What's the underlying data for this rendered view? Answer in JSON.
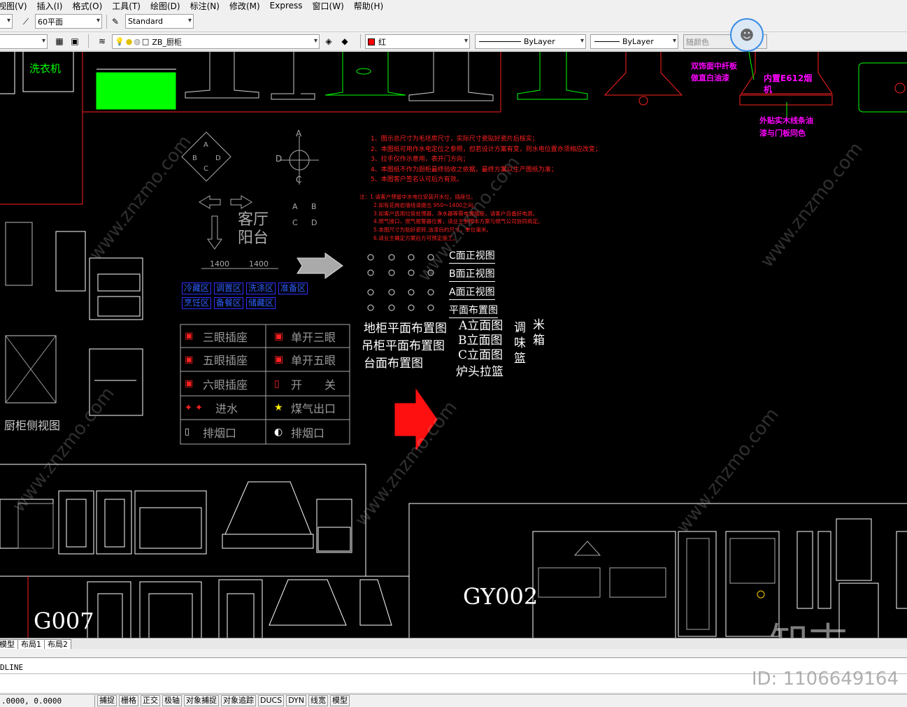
{
  "menu": [
    "视图(V)",
    "插入(I)",
    "格式(O)",
    "工具(T)",
    "绘图(D)",
    "标注(N)",
    "修改(M)",
    "Express",
    "窗口(W)",
    "帮助(H)"
  ],
  "toolbar1": {
    "dim_style": "60平面",
    "text_style": "Standard"
  },
  "toolbar2": {
    "layer": "ZB_厨柜",
    "color": "红",
    "linetype": "ByLayer",
    "lineweight": "ByLayer",
    "plotstyle": "随颜色"
  },
  "colors": {
    "canvas": "#000000",
    "red": "#ff2020",
    "green": "#00ff00",
    "magenta": "#ff00ff",
    "blue": "#3030ff",
    "white": "#ffffff"
  },
  "drawing": {
    "washer_label": "洗衣机",
    "annot_left": [
      "双饰面中纤板",
      "做直白油漆"
    ],
    "annot_built_in": [
      "内置E612烟",
      "机"
    ],
    "annot_right": [
      "外贴实木线条油",
      "漆与门板同色"
    ],
    "notes_red": [
      "1、图示总尺寸为毛坯房尺寸，实际尺寸瓷贴好瓷片后核实；",
      "2、本图纸可用作水电定位之参照，但若设计方案有变，则水电位置亦须相应改变；",
      "3、拉手仅作示意用，表开门方向；",
      "4、本图纸不作为厨柜最终验收之依据，最终方案以生产图纸为准；",
      "5、本图客户签名认可后方有效。"
    ],
    "notes_red2": [
      "注：1.请客户预留中水电位安装开水位，插座位。",
      "2.如有花岗岩墙线请提出 950～1400之间。",
      "3.如客户选用垃圾处理器，净水器等需电源插座，请客户自备好电源。",
      "4.燃气接口，燃气报警器位置，请业主参照本方案与燃气公司协同商定。",
      "5.本图尺寸为贴好瓷砖,油漆后的尺寸，单位毫米。",
      "6.请业主确定方案后方可预定施工。"
    ],
    "compass": [
      "A",
      "B",
      "C",
      "D"
    ],
    "room_labels": [
      "客厅",
      "阳台"
    ],
    "dims": [
      "1400",
      "1400"
    ],
    "zone_tags": [
      "冷藏区",
      "调置区",
      "洗涤区",
      "准备区",
      "烹饪区",
      "备餐区",
      "储藏区"
    ],
    "legend": [
      [
        "三眼插座",
        "单开三眼"
      ],
      [
        "五眼插座",
        "单开五眼"
      ],
      [
        "六眼插座",
        "开　　关"
      ],
      [
        "进水",
        "煤气出口"
      ],
      [
        "排烟口",
        "排烟口"
      ]
    ],
    "view_titles": [
      "C面正视图",
      "B面正视图",
      "A面正视图",
      "平面布置图"
    ],
    "plan_titles": [
      "地柜平面布置图",
      "吊柜平面布置图",
      "台面布置图"
    ],
    "elev_titles": [
      "A立面图",
      "B立面图",
      "C立面图",
      "炉头拉篮"
    ],
    "vertical_labels": [
      "调",
      "味",
      "篮",
      "米",
      "箱"
    ],
    "side_view": "厨柜侧视图",
    "code1": "G007",
    "code2": "GY002",
    "watermark": "www.znzmo.com"
  },
  "tabs": [
    "模型",
    "布局1",
    "布局2"
  ],
  "command_line": "DLINE",
  "status": {
    "coords": ".0000, 0.0000",
    "buttons": [
      "捕捉",
      "栅格",
      "正交",
      "极轴",
      "对象捕捉",
      "对象追踪",
      "DUCS",
      "DYN",
      "线宽",
      "模型"
    ]
  },
  "watermarks": {
    "logo": "知末",
    "id": "ID: 1106649164"
  }
}
